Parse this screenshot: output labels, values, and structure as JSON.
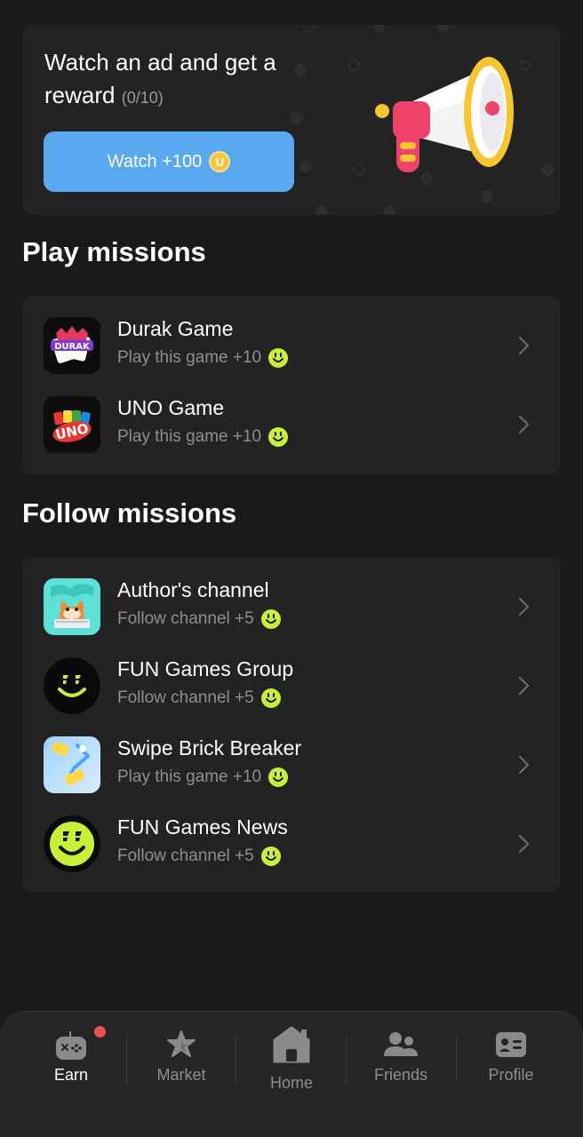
{
  "ad": {
    "title": "Watch an ad and get a reward",
    "count": "(0/10)",
    "button_label": "Watch +100",
    "coin_symbol": "U"
  },
  "play_section": {
    "title": "Play missions",
    "items": [
      {
        "title": "Durak Game",
        "subtitle": "Play this game +10",
        "icon": "durak-game-icon"
      },
      {
        "title": "UNO Game",
        "subtitle": "Play this game +10",
        "icon": "uno-game-icon"
      }
    ]
  },
  "follow_section": {
    "title": "Follow missions",
    "items": [
      {
        "title": "Author's channel",
        "subtitle": "Follow channel +5",
        "icon": "author-channel-icon"
      },
      {
        "title": "FUN Games Group",
        "subtitle": "Follow channel +5",
        "icon": "fun-games-group-icon"
      },
      {
        "title": "Swipe Brick Breaker",
        "subtitle": "Play this game +10",
        "icon": "brick-breaker-icon"
      },
      {
        "title": "FUN Games News",
        "subtitle": "Follow channel +5",
        "icon": "fun-games-news-icon"
      }
    ]
  },
  "nav": {
    "items": [
      {
        "label": "Earn",
        "icon": "gamepad-icon",
        "active": true,
        "badge": true
      },
      {
        "label": "Market",
        "icon": "star-icon",
        "active": false
      },
      {
        "label": "Home",
        "icon": "home-icon",
        "active": false
      },
      {
        "label": "Friends",
        "icon": "friends-icon",
        "active": false
      },
      {
        "label": "Profile",
        "icon": "profile-card-icon",
        "active": false
      }
    ]
  },
  "colors": {
    "background": "#1a1a1a",
    "card": "#232323",
    "accent_blue": "#5aa9f0",
    "reward_green": "#c8f03a",
    "badge_red": "#f0504f"
  }
}
